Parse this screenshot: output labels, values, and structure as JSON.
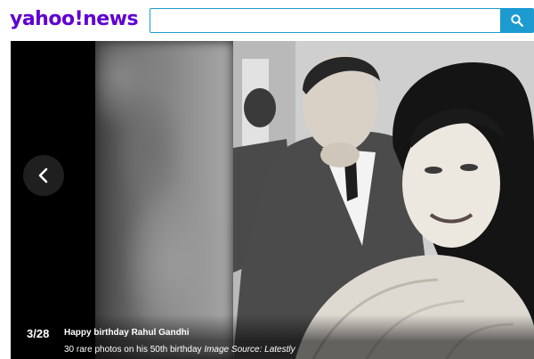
{
  "header": {
    "logo": {
      "brand": "yahoo",
      "mark": "!",
      "section": "news"
    },
    "search": {
      "value": "",
      "placeholder": ""
    },
    "search_icon": "search-icon"
  },
  "slideshow": {
    "counter": "3/28",
    "caption_title": "Happy birthday Rahul Gandhi",
    "caption_text": "30 rare photos on his 50th birthday",
    "image_source": "Image Source: Latestly",
    "prev_icon": "chevron-left-icon"
  },
  "colors": {
    "brand": "#6001d2",
    "search_accent": "#1d9bd1"
  }
}
